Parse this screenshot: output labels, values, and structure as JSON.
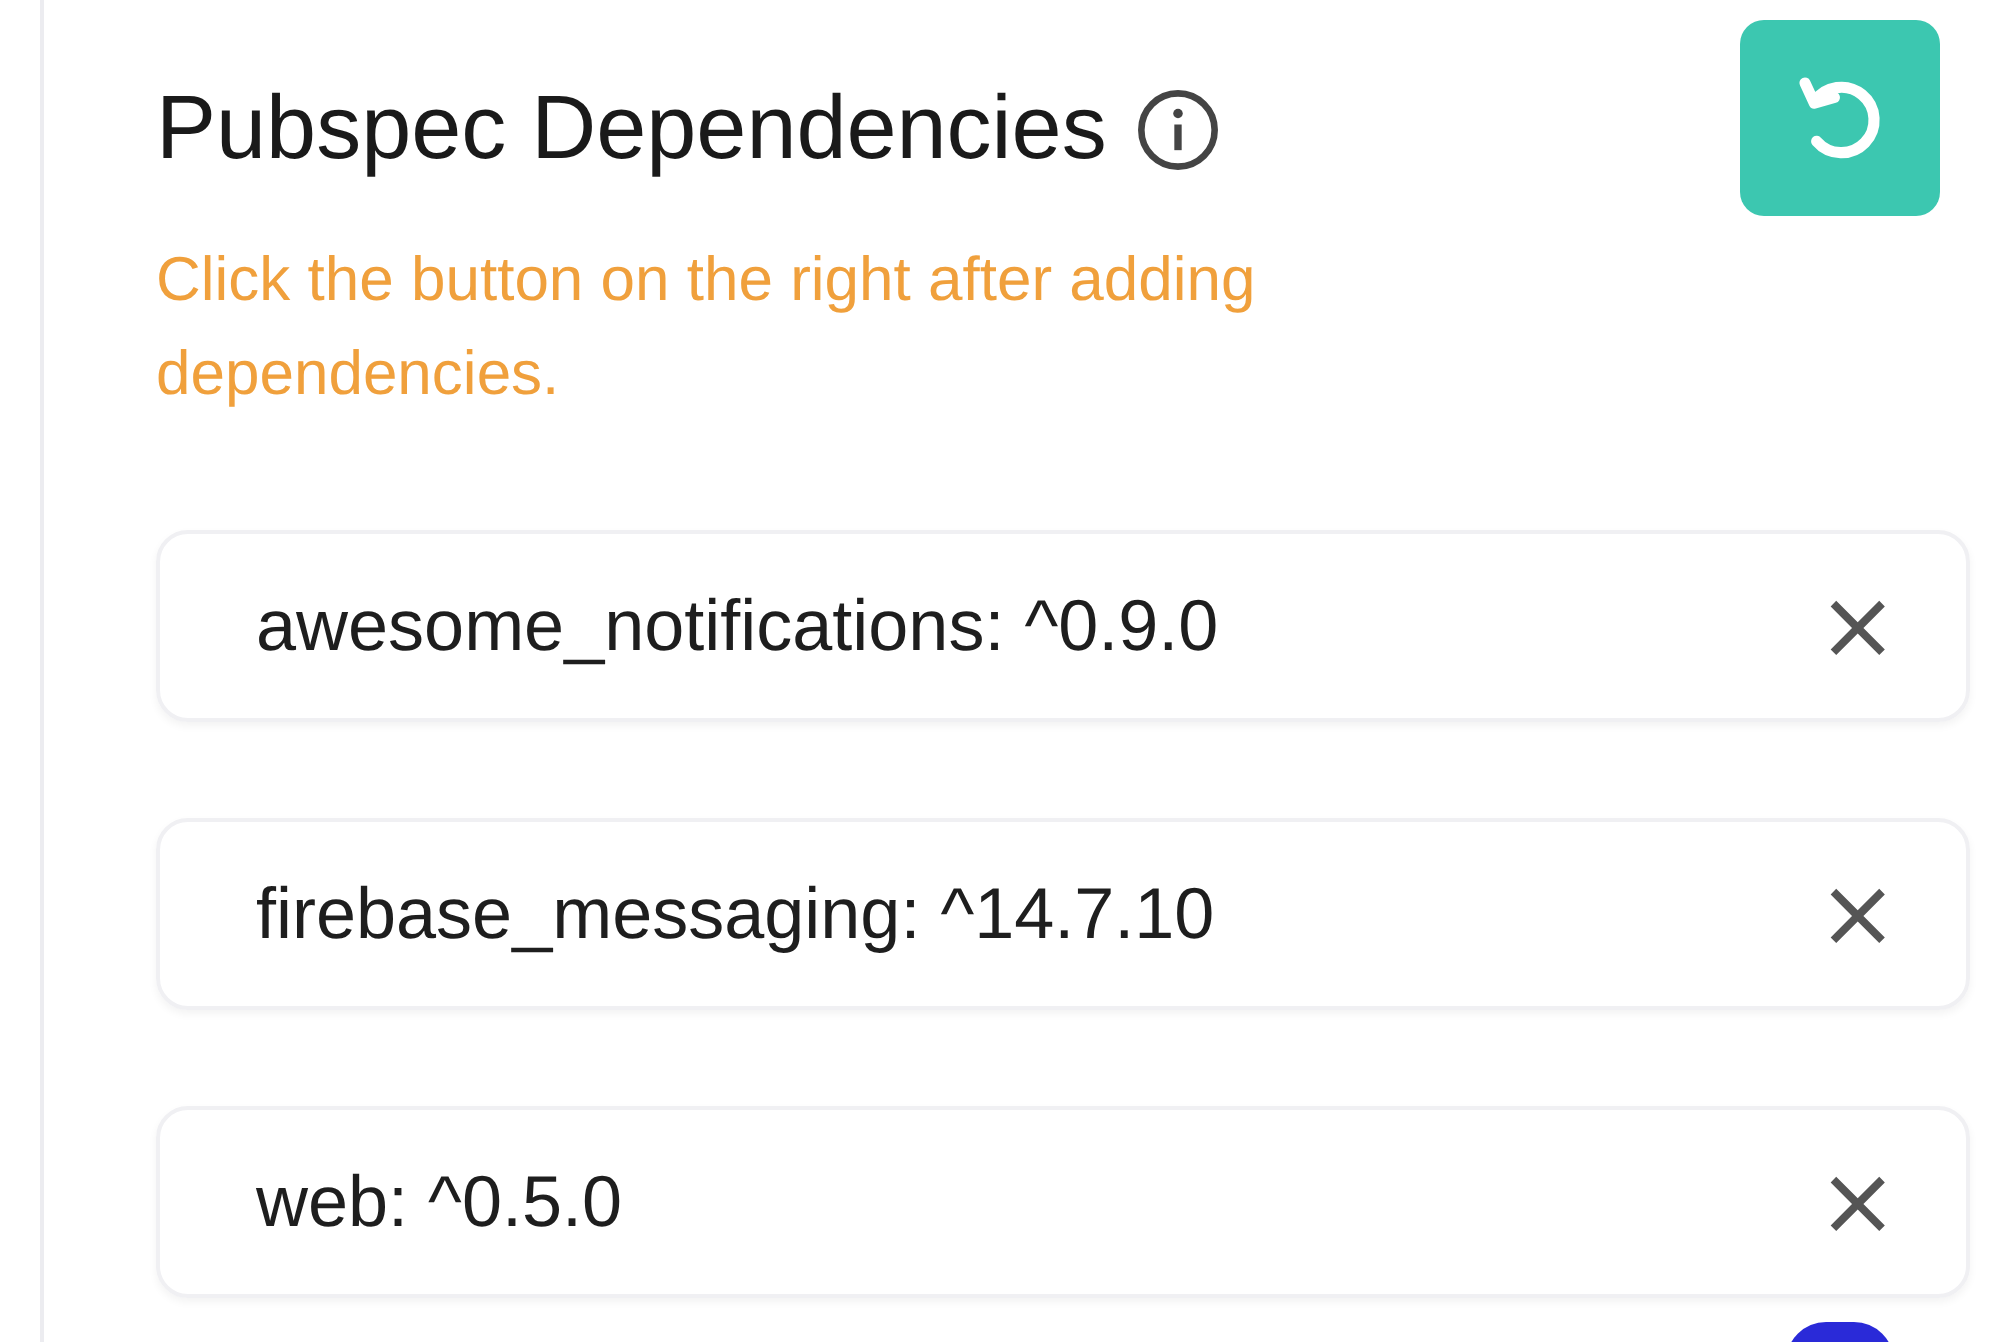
{
  "title": "Pubspec Dependencies",
  "hint": "Click the button on the right after adding dependencies.",
  "dependencies": [
    {
      "value": "awesome_notifications: ^0.9.0",
      "remove": "×"
    },
    {
      "value": "firebase_messaging: ^14.7.10",
      "remove": "×"
    },
    {
      "value": "web: ^0.5.0",
      "remove": "×"
    }
  ]
}
